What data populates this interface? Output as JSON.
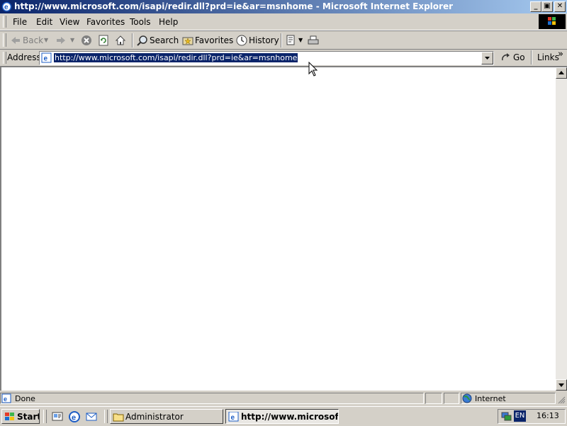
{
  "window": {
    "title": "http://www.microsoft.com/isapi/redir.dll?prd=ie&ar=msnhome - Microsoft Internet Explorer",
    "caption_buttons": {
      "minimize": "_",
      "restore": "▣",
      "close": "✕"
    }
  },
  "menubar": {
    "items": [
      "File",
      "Edit",
      "View",
      "Favorites",
      "Tools",
      "Help"
    ]
  },
  "toolbar": {
    "back_label": "Back",
    "search_label": "Search",
    "favorites_label": "Favorites",
    "history_label": "History",
    "icons": [
      "back-arrow-icon",
      "forward-arrow-icon",
      "stop-icon",
      "refresh-icon",
      "home-icon",
      "search-icon",
      "favorites-icon",
      "history-icon",
      "edit-icon",
      "print-icon"
    ]
  },
  "addressbar": {
    "label": "Address",
    "url": "http://www.microsoft.com/isapi/redir.dll?prd=ie&ar=msnhome",
    "go_label": "Go",
    "links_label": "Links",
    "links_chevron": "»"
  },
  "statusbar": {
    "status_text": "Done",
    "zone_text": "Internet"
  },
  "taskbar": {
    "start_label": "Start",
    "tasks": [
      {
        "label": "Administrator",
        "active": false
      },
      {
        "label": "http://www.microsoft....",
        "active": true
      }
    ],
    "language": "EN",
    "clock": "16:13"
  },
  "colors": {
    "titlebar_start": "#0a246a",
    "titlebar_end": "#a6caf0",
    "face": "#d4d0c8",
    "selection": "#0a246a"
  }
}
